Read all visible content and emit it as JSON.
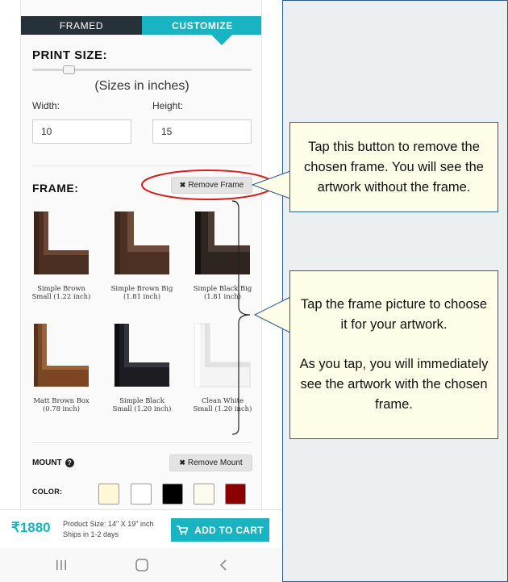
{
  "tabs": {
    "framed": "FRAMED",
    "customize": "CUSTOMIZE"
  },
  "print_size": {
    "title": "PRINT SIZE:",
    "units_note": "(Sizes in inches)",
    "width_label": "Width:",
    "height_label": "Height:",
    "width_value": "10",
    "height_value": "15"
  },
  "frame": {
    "title": "FRAME:",
    "remove_label": "Remove Frame",
    "items": [
      {
        "line1": "Simple Brown",
        "line2": "Small (1.22 inch)",
        "color": "#5a3a2a"
      },
      {
        "line1": "Simple Brown Big",
        "line2": "(1.81 inch)",
        "color": "#5a3a2a"
      },
      {
        "line1": "Simple Black Big",
        "line2": "(1.81 inch)",
        "color": "#2a221e"
      },
      {
        "line1": "Matt Brown Box",
        "line2": "(0.78 inch)",
        "color": "#7a4a2a"
      },
      {
        "line1": "Simple Black",
        "line2": "Small (1.20 inch)",
        "color": "#1e1e22"
      },
      {
        "line1": "Clean White",
        "line2": "Small (1.20 inch)",
        "color": "#f2f2f2"
      }
    ]
  },
  "mount": {
    "title": "MOUNT",
    "remove_label": "Remove Mount",
    "color_label": "COLOR:",
    "swatches": [
      "#fff8d8",
      "#ffffff",
      "#000000",
      "#fdfbee",
      "#8b0000"
    ]
  },
  "footer": {
    "price": "₹1880",
    "product_size": "Product Size: 14\" X 19\" inch",
    "ships": "Ships in 1-2 days",
    "cart_label": "ADD TO CART"
  },
  "callouts": {
    "remove_frame": "Tap this button to remove the chosen frame. You will see the artwork without the frame.",
    "choose_frame_1": "Tap the frame picture to choose it for your artwork.",
    "choose_frame_2": "As you tap, you will immediately see the artwork with the chosen frame."
  },
  "colors": {
    "accent": "#19b4c2",
    "dark_tab": "#263238",
    "annotation_red": "#d62020",
    "callout_border": "#2e5a8c"
  }
}
